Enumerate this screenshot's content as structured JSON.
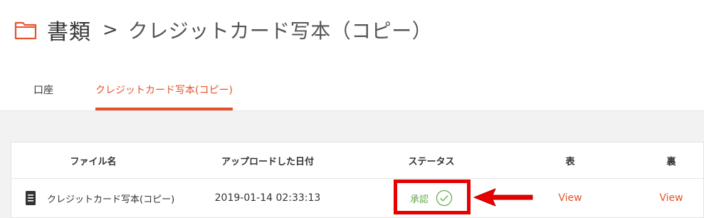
{
  "breadcrumb": {
    "root": "書類",
    "separator": ">",
    "current": "クレジットカード写本（コピー）"
  },
  "tabs": [
    {
      "label": "口座",
      "active": false
    },
    {
      "label": "クレジットカード写本(コピー)",
      "active": true
    }
  ],
  "table": {
    "headers": {
      "file_name": "ファイル名",
      "uploaded_at": "アップロードした日付",
      "status": "ステータス",
      "front": "表",
      "back": "裏"
    },
    "rows": [
      {
        "file_name": "クレジットカード写本(コピー)",
        "uploaded_at": "2019-01-14 02:33:13",
        "status": "承認",
        "front_link": "View",
        "back_link": "View"
      }
    ]
  },
  "colors": {
    "accent": "#e6522c",
    "approved": "#5fa84a",
    "annotation": "#e60000"
  },
  "icons": {
    "title": "folder-icon",
    "file": "document-icon",
    "status": "check-circle-icon",
    "annotation": "arrow-left-icon"
  }
}
